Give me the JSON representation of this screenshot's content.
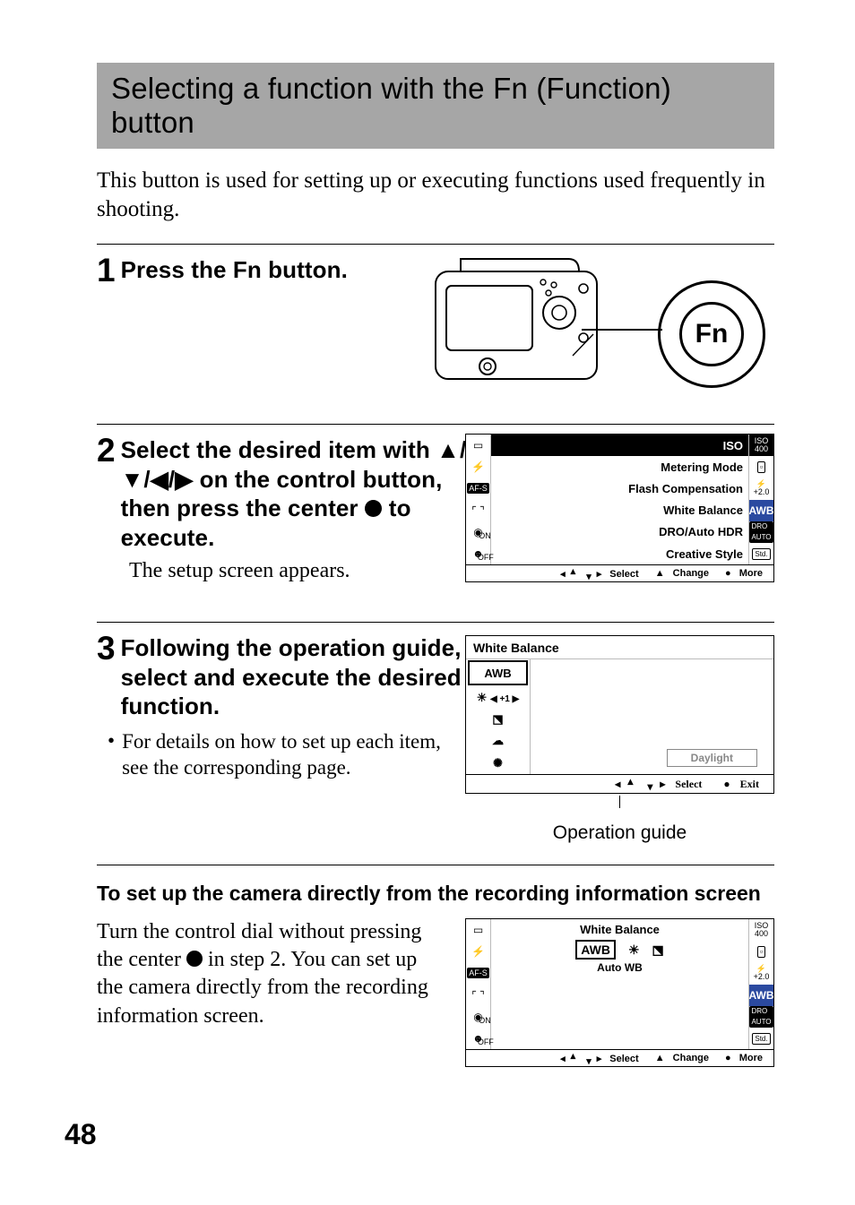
{
  "title": "Selecting a function with the Fn (Function) button",
  "intro": "This button is used for setting up or executing functions used frequently in shooting.",
  "step1": {
    "num": "1",
    "title": "Press the Fn button.",
    "fn_label": "Fn"
  },
  "step2": {
    "num": "2",
    "title_pre": "Select the desired item with ",
    "title_mid": " on the control button, then press the center ",
    "title_post": " to execute.",
    "body": "The setup screen appears.",
    "menu_rows": [
      "ISO",
      "Metering Mode",
      "Flash Compensation",
      "White Balance",
      "DRO/Auto HDR",
      "Creative Style"
    ],
    "right_badges_iso": "ISO\n400",
    "right_badge_awb": "AWB",
    "foot_select": "Select",
    "foot_change": "Change",
    "foot_more": "More"
  },
  "step3": {
    "num": "3",
    "title": "Following the operation guide, select and execute the desired function.",
    "bullet": "For details on how to set up each item, see the corresponding page.",
    "lcd_title": "White Balance",
    "list_awb": "AWB",
    "list_adj": "◀ +1 ▶",
    "daylight": "Daylight",
    "foot_select": "Select",
    "foot_exit": "Exit",
    "opguide": "Operation guide"
  },
  "subhead": "To set up the camera directly from the recording information screen",
  "direct": {
    "text_pre": "Turn the control dial without pressing the center ",
    "text_post": " in step 2. You can set up the camera directly from the recording information screen.",
    "lcd_title": "White Balance",
    "awb": "AWB",
    "auto_wb": "Auto WB",
    "right_awb": "AWB",
    "foot_select": "Select",
    "foot_change": "Change",
    "foot_more": "More"
  },
  "pagenum": "48"
}
